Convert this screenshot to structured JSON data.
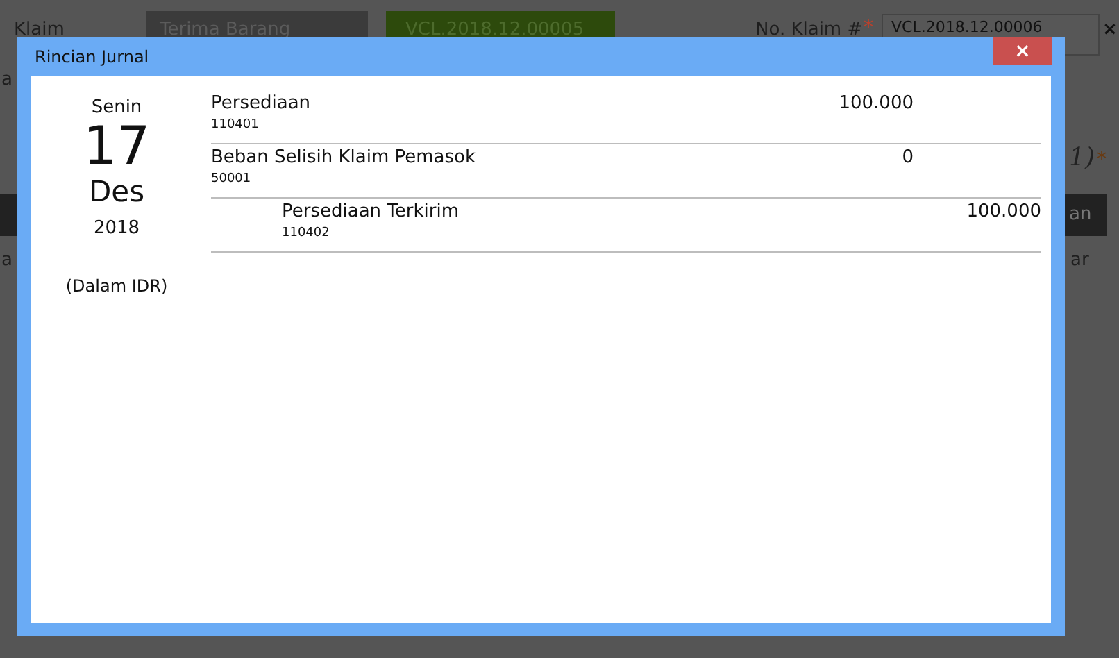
{
  "background": {
    "claim_type_label": "Klaim",
    "source_button": "Terima Barang",
    "reference_tag": "VCL.2018.12.00005",
    "claim_no_label": "No. Klaim #",
    "claim_no_required": "*",
    "claim_no_value": "VCL.2018.12.00006",
    "clear_icon": "×",
    "left_label": "a",
    "left_cell": "a",
    "count_label": "1)",
    "count_required": "*",
    "right_header": "an",
    "right_cell": "ar"
  },
  "dialog": {
    "title": "Rincian Jurnal",
    "close": "×",
    "date": {
      "weekday": "Senin",
      "day": "17",
      "month": "Des",
      "year": "2018"
    },
    "currency_note": "(Dalam IDR)",
    "entries": [
      {
        "kind": "debit",
        "account": "Persediaan",
        "code": "110401",
        "amount": "100.000"
      },
      {
        "kind": "debit",
        "account": "Beban Selisih Klaim Pemasok",
        "code": "50001",
        "amount": "0"
      },
      {
        "kind": "credit",
        "account": "Persediaan Terkirim",
        "code": "110402",
        "amount": "100.000"
      }
    ]
  }
}
